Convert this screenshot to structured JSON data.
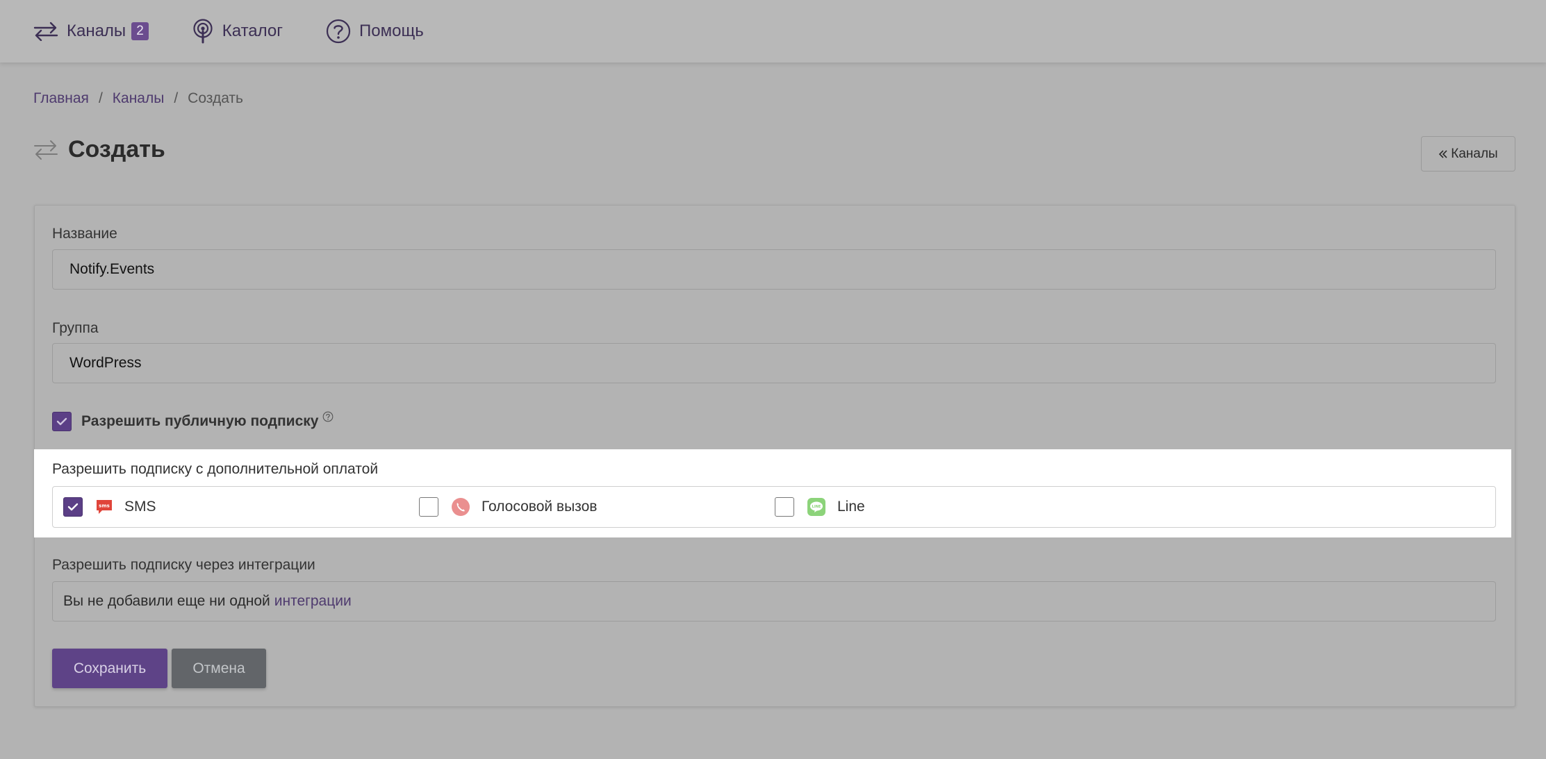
{
  "topnav": {
    "items": [
      {
        "label": "Каналы",
        "badge": "2",
        "icon": "arrows-exchange-icon"
      },
      {
        "label": "Каталог",
        "icon": "podcast-icon"
      },
      {
        "label": "Помощь",
        "icon": "question-circle-icon"
      }
    ]
  },
  "breadcrumb": {
    "home": "Главная",
    "channels": "Каналы",
    "current": "Создать",
    "separator": "/"
  },
  "page": {
    "title": "Создать",
    "title_icon": "arrows-exchange-icon",
    "back_button": "Каналы",
    "back_icon": "double-chevron-left-icon"
  },
  "form": {
    "name_label": "Название",
    "name_value": "Notify.Events",
    "group_label": "Группа",
    "group_value": "WordPress",
    "public_subscription_label": "Разрешить публичную подписку",
    "public_subscription_checked": true,
    "paid_subscription_label": "Разрешить подписку с дополнительной оплатой",
    "paid_options": [
      {
        "label": "SMS",
        "checked": true,
        "icon": "sms-icon",
        "color": "#e0443a"
      },
      {
        "label": "Голосовой вызов",
        "checked": false,
        "icon": "phone-call-icon",
        "color": "#ea8f8f"
      },
      {
        "label": "Line",
        "checked": false,
        "icon": "line-messenger-icon",
        "color": "#8cd37a"
      }
    ],
    "integrations_label": "Разрешить подписку через интеграции",
    "integrations_text": "Вы не добавили еще ни одной",
    "integrations_link": "интеграции",
    "save_button": "Сохранить",
    "cancel_button": "Отмена"
  },
  "colors": {
    "accent": "#5e4387",
    "overlay_bg": "#b3b3b3",
    "highlight_bg": "#ffffff",
    "link": "#4e3a6e"
  }
}
